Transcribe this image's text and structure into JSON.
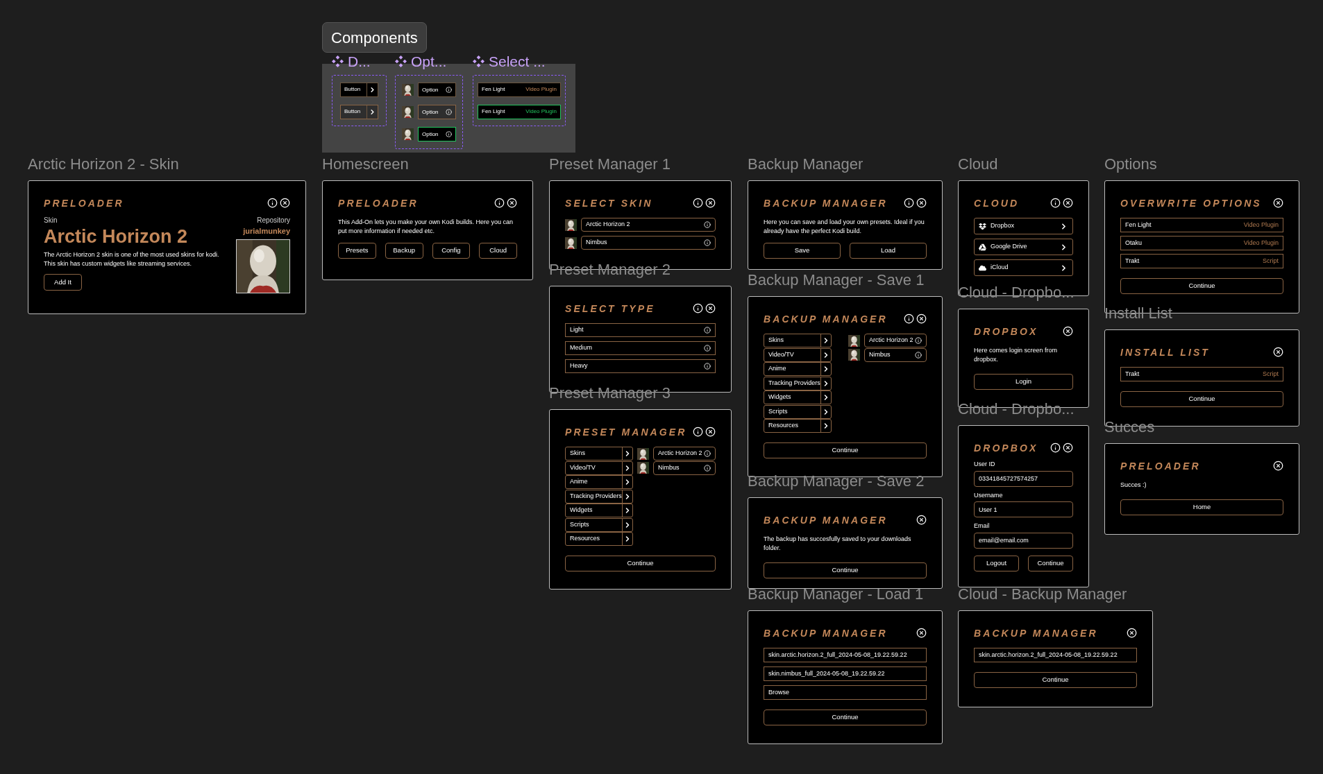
{
  "components": {
    "tag": "Components",
    "sets": [
      {
        "title": "D...",
        "kind": "chevron_button",
        "items": [
          {
            "label": "Button",
            "kind": "default"
          },
          {
            "label": "Button",
            "kind": "hover"
          }
        ]
      },
      {
        "title": "Opt...",
        "kind": "avatar_option",
        "items": [
          {
            "label": "Option",
            "kind": "default"
          },
          {
            "label": "Option",
            "kind": "hover"
          },
          {
            "label": "Option",
            "kind": "active"
          }
        ]
      },
      {
        "title": "Select ...",
        "kind": "plugin_row",
        "items": [
          {
            "name": "Fen Light",
            "type": "Video Plugin",
            "kind": "default"
          },
          {
            "name": "Fen Light",
            "type": "Video Plugin",
            "kind": "active"
          }
        ]
      }
    ]
  },
  "frames": [
    {
      "label": "Arctic Horizon 2 - Skin",
      "title": "PRELOADER",
      "info": true,
      "blocks": [
        {
          "kind": "skin",
          "skin_label": "Skin",
          "name": "Arctic Horizon 2",
          "description": "The Arctic Horizon 2 skin is one of the most used skins for kodi. This skin has custom widgets like streaming services.",
          "button": "Add It",
          "repository_label": "Repository",
          "repository": "jurialmunkey"
        }
      ]
    },
    {
      "label": "Homescreen",
      "title": "PRELOADER",
      "info": true,
      "blocks": [
        {
          "kind": "paragraph",
          "text": "This Add-On lets you make your own Kodi builds. Here you can put more information if needed etc."
        },
        {
          "kind": "button_row",
          "buttons": [
            "Presets",
            "Backup",
            "Config",
            "Cloud"
          ]
        }
      ]
    },
    {
      "label": "Preset Manager 1",
      "title": "SELECT SKIN",
      "info": true,
      "blocks": [
        {
          "kind": "avatar_options",
          "items": [
            "Arctic Horizon 2",
            "Nimbus"
          ]
        }
      ]
    },
    {
      "label": "Preset Manager 2",
      "title": "SELECT TYPE",
      "info": true,
      "blocks": [
        {
          "kind": "options",
          "items": [
            "Light",
            "Medium",
            "Heavy"
          ]
        }
      ]
    },
    {
      "label": "Preset Manager 3",
      "title": "PRESET MANAGER",
      "info": true,
      "blocks": [
        {
          "kind": "split",
          "categories": [
            "Skins",
            "Video/TV",
            "Anime",
            "Tracking Providers",
            "Widgets",
            "Scripts",
            "Resources"
          ],
          "options": [
            "Arctic Horizon 2",
            "Nimbus"
          ]
        },
        {
          "kind": "wide_button",
          "label": "Continue"
        }
      ]
    },
    {
      "label": "Backup Manager",
      "title": "BACKUP MANAGER",
      "info": true,
      "blocks": [
        {
          "kind": "paragraph",
          "text": "Here you can save and load your own presets. Ideal if you already have the perfect Kodi build."
        },
        {
          "kind": "button_row",
          "buttons": [
            "Save",
            "Load"
          ]
        }
      ]
    },
    {
      "label": "Backup Manager - Save 1",
      "title": "BACKUP MANAGER",
      "info": true,
      "blocks": [
        {
          "kind": "split",
          "categories": [
            "Skins",
            "Video/TV",
            "Anime",
            "Tracking Providers",
            "Widgets",
            "Scripts",
            "Resources"
          ],
          "options": [
            "Arctic Horizon 2",
            "Nimbus"
          ]
        },
        {
          "kind": "wide_button",
          "label": "Continue"
        }
      ]
    },
    {
      "label": "Backup Manager - Save 2",
      "title": "BACKUP MANAGER",
      "info": false,
      "blocks": [
        {
          "kind": "paragraph",
          "text": "The backup has succesfully saved to your downloads folder."
        },
        {
          "kind": "wide_button",
          "label": "Continue"
        }
      ]
    },
    {
      "label": "Backup Manager - Load 1",
      "title": "BACKUP MANAGER",
      "info": false,
      "blocks": [
        {
          "kind": "file_list",
          "items": [
            "skin.arctic.horizon.2_full_2024-05-08_19.22.59.22",
            "skin.nimbus_full_2024-05-08_19.22.59.22",
            "Browse"
          ]
        },
        {
          "kind": "wide_button",
          "label": "Continue"
        }
      ]
    },
    {
      "label": "Cloud",
      "title": "CLOUD",
      "info": true,
      "blocks": [
        {
          "kind": "cloud_list",
          "items": [
            {
              "label": "Dropbox",
              "kind": "dropbox"
            },
            {
              "label": "Google Drive",
              "kind": "drive"
            },
            {
              "label": "iCloud",
              "kind": "cloud"
            }
          ]
        }
      ]
    },
    {
      "label": "Cloud - Dropbo...",
      "title": "DROPBOX",
      "info": false,
      "blocks": [
        {
          "kind": "paragraph",
          "text": "Here comes login screen from dropbox."
        },
        {
          "kind": "wide_button",
          "label": "Login"
        }
      ]
    },
    {
      "label": "Cloud - Dropbo...",
      "title": "DROPBOX",
      "info": true,
      "blocks": [
        {
          "kind": "fields",
          "items": [
            {
              "label": "User ID",
              "value": "03341845727574257"
            },
            {
              "label": "Username",
              "value": "User 1"
            },
            {
              "label": "Email",
              "value": "email@email.com"
            }
          ]
        },
        {
          "kind": "button_row",
          "buttons": [
            "Logout",
            "Continue"
          ]
        }
      ]
    },
    {
      "label": "Cloud - Backup Manager",
      "title": "BACKUP MANAGER",
      "info": false,
      "blocks": [
        {
          "kind": "file_list",
          "items": [
            "skin.arctic.horizon.2_full_2024-05-08_19.22.59.22"
          ]
        },
        {
          "kind": "wide_button",
          "label": "Continue"
        }
      ]
    },
    {
      "label": "Options",
      "title": "OVERWRITE OPTIONS",
      "info": false,
      "blocks": [
        {
          "kind": "plugin_list",
          "items": [
            {
              "name": "Fen Light",
              "type": "Video Plugin"
            },
            {
              "name": "Otaku",
              "type": "Video Plugin"
            },
            {
              "name": "Trakt",
              "type": "Script"
            }
          ]
        },
        {
          "kind": "wide_button",
          "label": "Continue"
        }
      ]
    },
    {
      "label": "Install List",
      "title": "INSTALL LIST",
      "info": false,
      "blocks": [
        {
          "kind": "plugin_list",
          "items": [
            {
              "name": "Trakt",
              "type": "Script"
            }
          ]
        },
        {
          "kind": "wide_button",
          "label": "Continue"
        }
      ]
    },
    {
      "label": "Succes",
      "title": "PRELOADER",
      "info": false,
      "blocks": [
        {
          "kind": "paragraph",
          "text": "Succes :)"
        },
        {
          "kind": "wide_button",
          "label": "Home"
        }
      ]
    }
  ]
}
